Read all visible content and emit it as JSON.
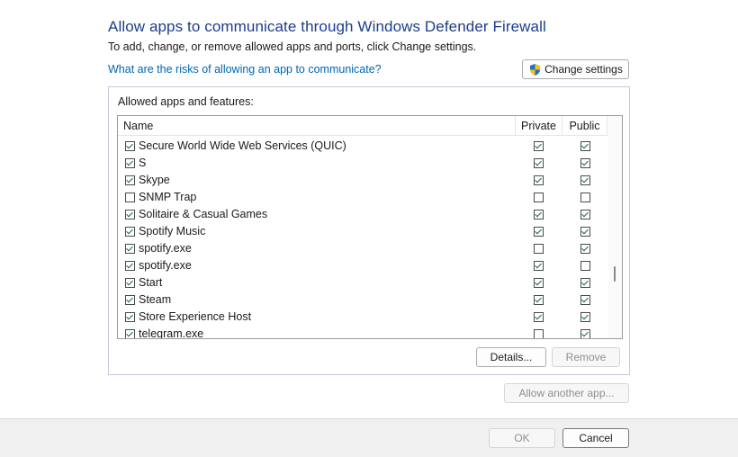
{
  "header": {
    "title": "Allow apps to communicate through Windows Defender Firewall",
    "subtitle": "To add, change, or remove allowed apps and ports, click Change settings.",
    "risk_link": "What are the risks of allowing an app to communicate?",
    "change_settings_label": "Change settings"
  },
  "group": {
    "label": "Allowed apps and features:",
    "columns": {
      "name": "Name",
      "private": "Private",
      "public": "Public"
    },
    "rows": [
      {
        "name": "Secure World Wide Web Services (QUIC)",
        "enabled": true,
        "private": true,
        "public": true
      },
      {
        "name": "S",
        "enabled": true,
        "private": true,
        "public": true
      },
      {
        "name": "Skype",
        "enabled": true,
        "private": true,
        "public": true
      },
      {
        "name": "SNMP Trap",
        "enabled": false,
        "private": false,
        "public": false
      },
      {
        "name": "Solitaire & Casual Games",
        "enabled": true,
        "private": true,
        "public": true
      },
      {
        "name": "Spotify Music",
        "enabled": true,
        "private": true,
        "public": true
      },
      {
        "name": "spotify.exe",
        "enabled": true,
        "private": false,
        "public": true
      },
      {
        "name": "spotify.exe",
        "enabled": true,
        "private": true,
        "public": false
      },
      {
        "name": "Start",
        "enabled": true,
        "private": true,
        "public": true
      },
      {
        "name": "Steam",
        "enabled": true,
        "private": true,
        "public": true
      },
      {
        "name": "Store Experience Host",
        "enabled": true,
        "private": true,
        "public": true
      },
      {
        "name": "telegram.exe",
        "enabled": true,
        "private": false,
        "public": true
      }
    ],
    "details_label": "Details...",
    "remove_label": "Remove"
  },
  "allow_another_label": "Allow another app...",
  "footer": {
    "ok_label": "OK",
    "cancel_label": "Cancel"
  },
  "colors": {
    "title": "#1c3d8c",
    "link": "#0066b4",
    "check": "#1a6a3a"
  },
  "icons": {
    "change_settings": "uac-shield-icon"
  }
}
